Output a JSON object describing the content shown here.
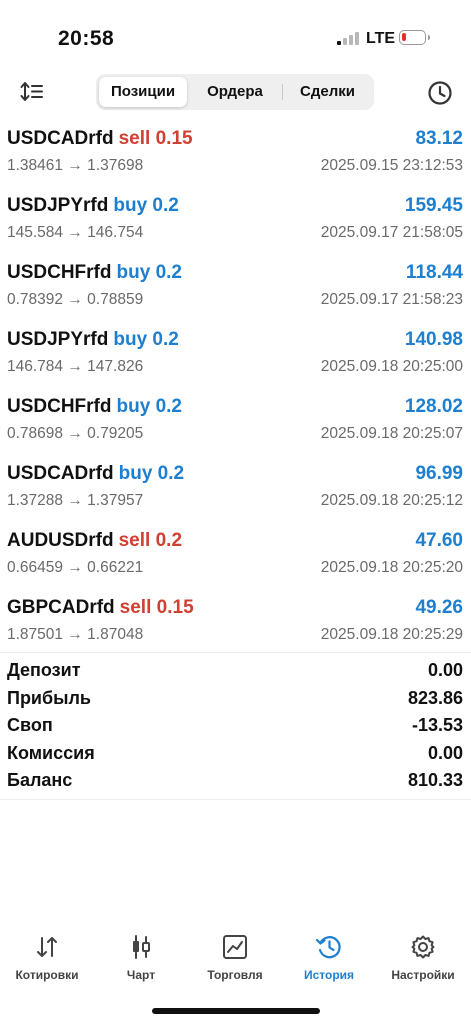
{
  "status_bar": {
    "time": "20:58",
    "network": "LTE",
    "battery_color": "#e03030"
  },
  "toolbar": {
    "tabs": [
      {
        "label": "Позиции",
        "active": true
      },
      {
        "label": "Ордера",
        "active": false
      },
      {
        "label": "Сделки",
        "active": false
      }
    ]
  },
  "trades": [
    {
      "symbol": "USDCADrfd",
      "side": "sell",
      "volume": "0.15",
      "profit": "83.12",
      "open_price": "1.38461",
      "close_price": "1.37698",
      "time": "2025.09.15 23:12:53"
    },
    {
      "symbol": "USDJPYrfd",
      "side": "buy",
      "volume": "0.2",
      "profit": "159.45",
      "open_price": "145.584",
      "close_price": "146.754",
      "time": "2025.09.17 21:58:05"
    },
    {
      "symbol": "USDCHFrfd",
      "side": "buy",
      "volume": "0.2",
      "profit": "118.44",
      "open_price": "0.78392",
      "close_price": "0.78859",
      "time": "2025.09.17 21:58:23"
    },
    {
      "symbol": "USDJPYrfd",
      "side": "buy",
      "volume": "0.2",
      "profit": "140.98",
      "open_price": "146.784",
      "close_price": "147.826",
      "time": "2025.09.18 20:25:00"
    },
    {
      "symbol": "USDCHFrfd",
      "side": "buy",
      "volume": "0.2",
      "profit": "128.02",
      "open_price": "0.78698",
      "close_price": "0.79205",
      "time": "2025.09.18 20:25:07"
    },
    {
      "symbol": "USDCADrfd",
      "side": "buy",
      "volume": "0.2",
      "profit": "96.99",
      "open_price": "1.37288",
      "close_price": "1.37957",
      "time": "2025.09.18 20:25:12"
    },
    {
      "symbol": "AUDUSDrfd",
      "side": "sell",
      "volume": "0.2",
      "profit": "47.60",
      "open_price": "0.66459",
      "close_price": "0.66221",
      "time": "2025.09.18 20:25:20"
    },
    {
      "symbol": "GBPCADrfd",
      "side": "sell",
      "volume": "0.15",
      "profit": "49.26",
      "open_price": "1.87501",
      "close_price": "1.87048",
      "time": "2025.09.18 20:25:29"
    }
  ],
  "arrow": "→",
  "summary": [
    {
      "label": "Депозит",
      "value": "0.00"
    },
    {
      "label": "Прибыль",
      "value": "823.86"
    },
    {
      "label": "Своп",
      "value": "-13.53"
    },
    {
      "label": "Комиссия",
      "value": "0.00"
    },
    {
      "label": "Баланс",
      "value": "810.33"
    }
  ],
  "tabbar": [
    {
      "label": "Котировки",
      "icon": "quotes-icon",
      "active": false
    },
    {
      "label": "Чарт",
      "icon": "chart-icon",
      "active": false
    },
    {
      "label": "Торговля",
      "icon": "trade-icon",
      "active": false
    },
    {
      "label": "История",
      "icon": "history-icon",
      "active": true
    },
    {
      "label": "Настройки",
      "icon": "gear-icon",
      "active": false
    }
  ],
  "colors": {
    "buy": "#1d7fd0",
    "sell": "#cf4031",
    "profit": "#1d7fd0",
    "active_tab": "#1d7fd0"
  }
}
